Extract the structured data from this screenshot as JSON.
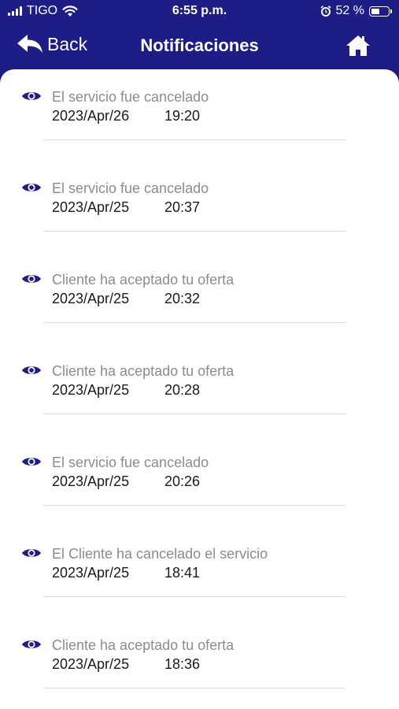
{
  "status_bar": {
    "carrier": "TIGO",
    "time": "6:55 p.m.",
    "battery_percent": "52 %",
    "battery_level": 0.52
  },
  "header": {
    "back_label": "Back",
    "title": "Notificaciones",
    "home_icon": "home-icon"
  },
  "colors": {
    "primary": "#1e1c85",
    "message_text": "#8c8c8c",
    "date_text": "#1a1a1a"
  },
  "notifications": [
    {
      "message": "El servicio fue cancelado",
      "date": "2023/Apr/26",
      "time": "19:20"
    },
    {
      "message": "El servicio fue cancelado",
      "date": "2023/Apr/25",
      "time": "20:37"
    },
    {
      "message": "Cliente ha aceptado tu oferta",
      "date": "2023/Apr/25",
      "time": "20:32"
    },
    {
      "message": "Cliente ha aceptado tu oferta",
      "date": "2023/Apr/25",
      "time": "20:28"
    },
    {
      "message": "El servicio fue cancelado",
      "date": "2023/Apr/25",
      "time": "20:26"
    },
    {
      "message": "El Cliente ha cancelado el servicio",
      "date": "2023/Apr/25",
      "time": "18:41"
    },
    {
      "message": "Cliente ha aceptado tu oferta",
      "date": "2023/Apr/25",
      "time": "18:36"
    }
  ]
}
